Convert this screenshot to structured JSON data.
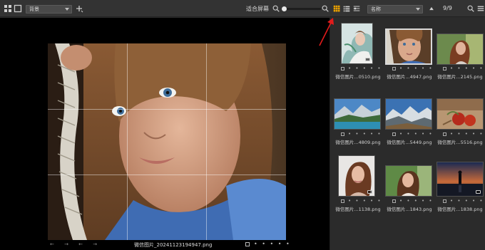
{
  "toolbar": {
    "view_modes": [
      "grid-view-icon",
      "single-view-icon"
    ],
    "preset_select": {
      "value": "背景"
    },
    "fit_label": "适合屏幕",
    "zoom_fraction": 0.0,
    "sort_select": {
      "value": "名称"
    },
    "counter": "9/9",
    "accent": "#e8a000"
  },
  "viewer": {
    "filename": "微信图片_20241123194947.png",
    "nav_glyphs": "← → ← →",
    "rating_dots": "• • • • •"
  },
  "thumbnails": [
    {
      "name": "微信图片...0510.png",
      "selected": false,
      "badge": true,
      "rating": "• • • • •"
    },
    {
      "name": "微信图片...4947.png",
      "selected": true,
      "badge": false,
      "rating": "• • • • •"
    },
    {
      "name": "微信图片...2145.png",
      "selected": false,
      "badge": false,
      "rating": "• • • • •"
    },
    {
      "name": "微信图片...4809.png",
      "selected": false,
      "badge": false,
      "rating": "• • • • •"
    },
    {
      "name": "微信图片...5449.png",
      "selected": false,
      "badge": false,
      "rating": "• • • • •"
    },
    {
      "name": "微信图片...5516.png",
      "selected": false,
      "badge": false,
      "rating": "• • • • •"
    },
    {
      "name": "微信图片...1138.png",
      "selected": false,
      "badge": true,
      "rating": "• • • • •"
    },
    {
      "name": "微信图片...1843.png",
      "selected": false,
      "badge": false,
      "rating": "• • • • •"
    },
    {
      "name": "微信图片...1838.png",
      "selected": false,
      "badge": true,
      "rating": "• • • • •"
    }
  ]
}
